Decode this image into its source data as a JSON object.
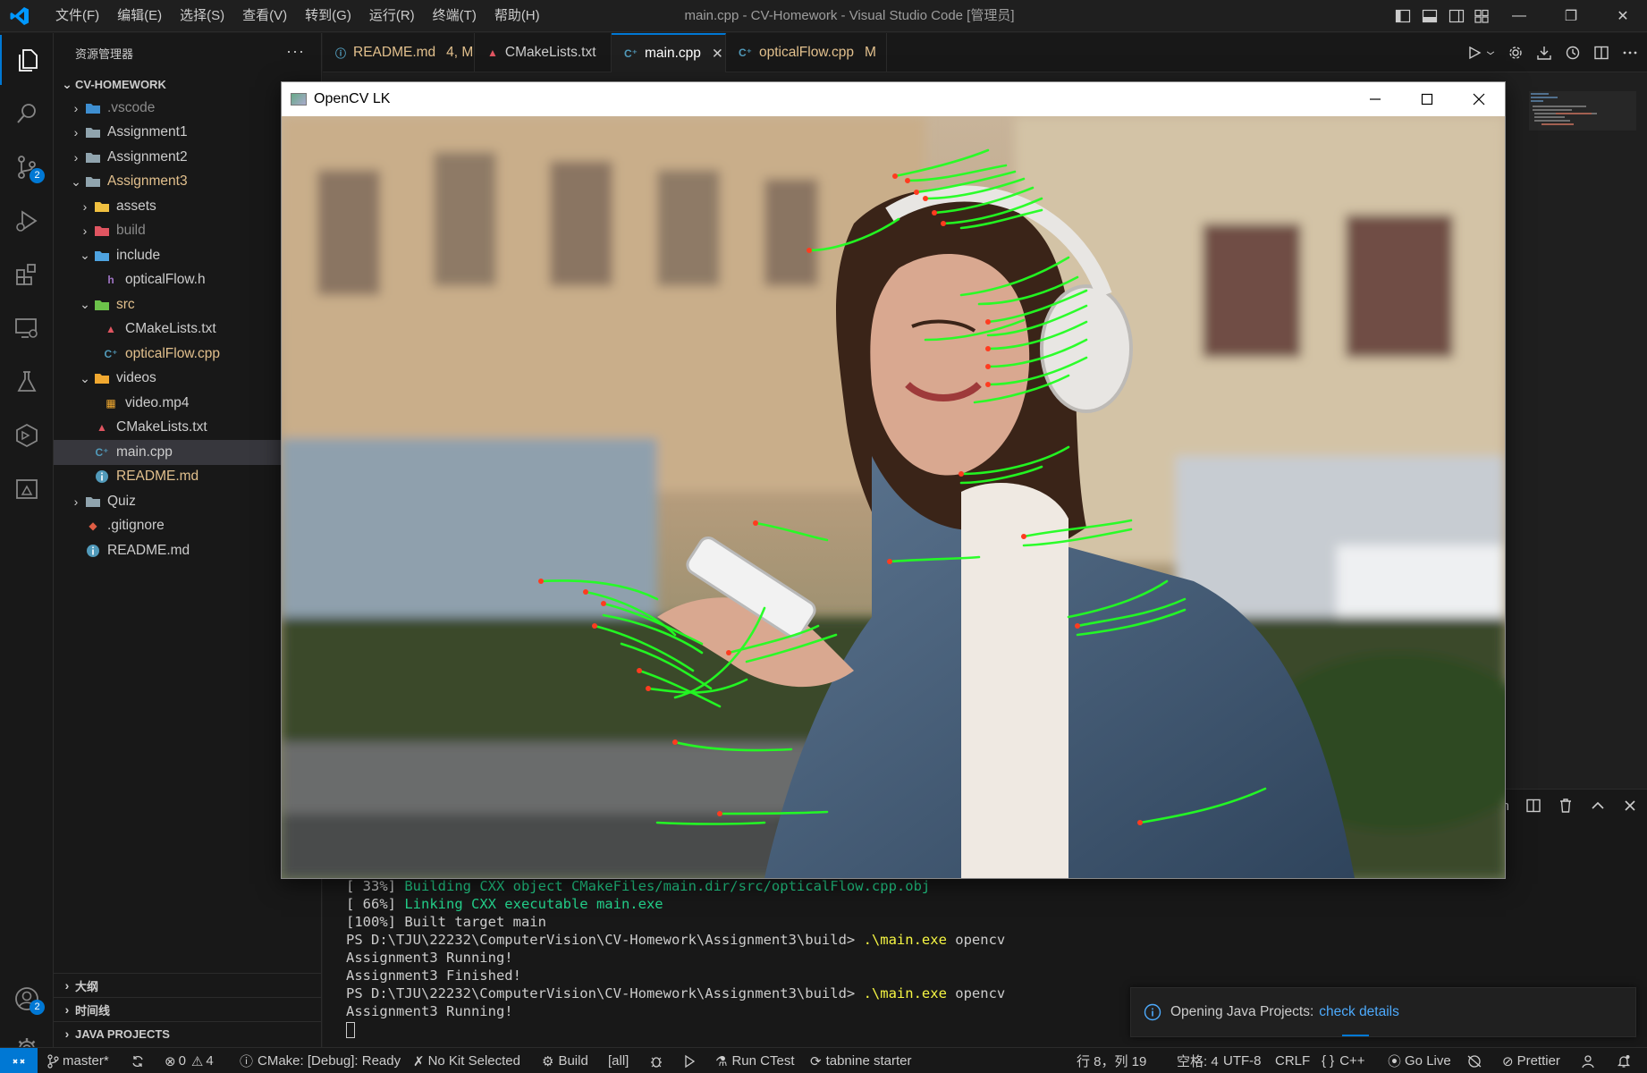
{
  "titlebar": {
    "menus": [
      "文件(F)",
      "编辑(E)",
      "选择(S)",
      "查看(V)",
      "转到(G)",
      "运行(R)",
      "终端(T)",
      "帮助(H)"
    ],
    "window_title": "main.cpp - CV-Homework - Visual Studio Code [管理员]"
  },
  "activity": {
    "source_control_badge": "2",
    "accounts_badge": "2"
  },
  "sidebar": {
    "header": "资源管理器",
    "more": "···",
    "workspace": "CV-HOMEWORK",
    "tree": [
      {
        "label": ".vscode",
        "depth": 0,
        "chev": "›",
        "icon": "folder-vscode",
        "color": "#8a8a8a"
      },
      {
        "label": "Assignment1",
        "depth": 0,
        "chev": "›",
        "icon": "folder",
        "color": "#cccccc"
      },
      {
        "label": "Assignment2",
        "depth": 0,
        "chev": "›",
        "icon": "folder",
        "color": "#cccccc"
      },
      {
        "label": "Assignment3",
        "depth": 0,
        "chev": "⌄",
        "icon": "folder-open",
        "color": "#e2c08d"
      },
      {
        "label": "assets",
        "depth": 1,
        "chev": "›",
        "icon": "folder-assets",
        "color": "#cccccc"
      },
      {
        "label": "build",
        "depth": 1,
        "chev": "›",
        "icon": "folder-build",
        "color": "#8a8a8a"
      },
      {
        "label": "include",
        "depth": 1,
        "chev": "⌄",
        "icon": "folder-include",
        "color": "#cccccc"
      },
      {
        "label": "opticalFlow.h",
        "depth": 2,
        "chev": "",
        "icon": "h-file",
        "color": "#cccccc"
      },
      {
        "label": "src",
        "depth": 1,
        "chev": "⌄",
        "icon": "folder-src",
        "color": "#e2c08d"
      },
      {
        "label": "CMakeLists.txt",
        "depth": 2,
        "chev": "",
        "icon": "cmake",
        "color": "#cccccc"
      },
      {
        "label": "opticalFlow.cpp",
        "depth": 2,
        "chev": "",
        "icon": "cpp",
        "color": "#e2c08d"
      },
      {
        "label": "videos",
        "depth": 1,
        "chev": "⌄",
        "icon": "folder-video",
        "color": "#cccccc"
      },
      {
        "label": "video.mp4",
        "depth": 2,
        "chev": "",
        "icon": "video",
        "color": "#cccccc"
      },
      {
        "label": "CMakeLists.txt",
        "depth": 1,
        "chev": "",
        "icon": "cmake",
        "color": "#cccccc"
      },
      {
        "label": "main.cpp",
        "depth": 1,
        "chev": "",
        "icon": "cpp",
        "color": "#cccccc",
        "selected": true
      },
      {
        "label": "README.md",
        "depth": 1,
        "chev": "",
        "icon": "info",
        "color": "#e2c08d"
      },
      {
        "label": "Quiz",
        "depth": 0,
        "chev": "›",
        "icon": "folder",
        "color": "#cccccc"
      },
      {
        "label": ".gitignore",
        "depth": 0,
        "chev": "",
        "icon": "git",
        "color": "#cccccc"
      },
      {
        "label": "README.md",
        "depth": 0,
        "chev": "",
        "icon": "info",
        "color": "#cccccc"
      }
    ],
    "outline_sections": [
      "大纲",
      "时间线",
      "JAVA PROJECTS"
    ]
  },
  "tabs": [
    {
      "label": "README.md",
      "suffix": "4, M",
      "icon": "info",
      "color": "#e2c08d",
      "suffix_color": "#e2c08d"
    },
    {
      "label": "CMakeLists.txt",
      "suffix": "",
      "icon": "cmake",
      "color": "#cccccc",
      "suffix_color": "#cccccc"
    },
    {
      "label": "main.cpp",
      "suffix": "✕",
      "icon": "cpp",
      "color": "#ffffff",
      "suffix_color": "#cccccc",
      "active": true
    },
    {
      "label": "opticalFlow.cpp",
      "suffix": "M",
      "icon": "cpp",
      "color": "#e2c08d",
      "suffix_color": "#e2c08d"
    }
  ],
  "panel": {
    "terminal_name_fragment": "ain",
    "lines": [
      {
        "segments": [
          {
            "text": "[ 33%] ",
            "cls": ""
          },
          {
            "text": "Building CXX object CMakeFiles/main.dir/src/opticalFlow.cpp.obj",
            "cls": "t-green"
          }
        ]
      },
      {
        "segments": [
          {
            "text": "[ 66%] ",
            "cls": ""
          },
          {
            "text": "Linking CXX executable main.exe",
            "cls": "t-green"
          }
        ]
      },
      {
        "segments": [
          {
            "text": "[100%] Built target main",
            "cls": ""
          }
        ]
      },
      {
        "segments": [
          {
            "text": "PS D:\\TJU\\22232\\ComputerVision\\CV-Homework\\Assignment3\\build> ",
            "cls": ""
          },
          {
            "text": ".\\main.exe",
            "cls": "t-yellow"
          },
          {
            "text": " opencv",
            "cls": ""
          }
        ]
      },
      {
        "segments": [
          {
            "text": "Assignment3 Running!",
            "cls": ""
          }
        ]
      },
      {
        "segments": [
          {
            "text": "Assignment3 Finished!",
            "cls": ""
          }
        ]
      },
      {
        "segments": [
          {
            "text": "PS D:\\TJU\\22232\\ComputerVision\\CV-Homework\\Assignment3\\build> ",
            "cls": ""
          },
          {
            "text": ".\\main.exe",
            "cls": "t-yellow"
          },
          {
            "text": " opencv",
            "cls": ""
          }
        ]
      },
      {
        "segments": [
          {
            "text": "Assignment3 Running!",
            "cls": ""
          }
        ]
      }
    ]
  },
  "notification": {
    "message": "Opening Java Projects:",
    "link": "check details"
  },
  "statusbar": {
    "branch": "master*",
    "errors": "0",
    "warnings": "4",
    "cmake_status": "CMake: [Debug]: Ready",
    "kit": "No Kit Selected",
    "build": "Build",
    "target": "[all]",
    "ctest": "Run CTest",
    "tabnine": "tabnine starter",
    "position": "行 8，列 19",
    "spaces": "空格: 4",
    "encoding": "UTF-8",
    "eol": "CRLF",
    "language": "C++",
    "golive": "Go Live",
    "prettier": "Prettier"
  },
  "cvwindow": {
    "title": "OpenCV LK"
  },
  "colors": {
    "accent": "#0078d4",
    "modified": "#e2c08d",
    "flow_track": "#22ff22",
    "flow_point": "#ff3b1f"
  }
}
